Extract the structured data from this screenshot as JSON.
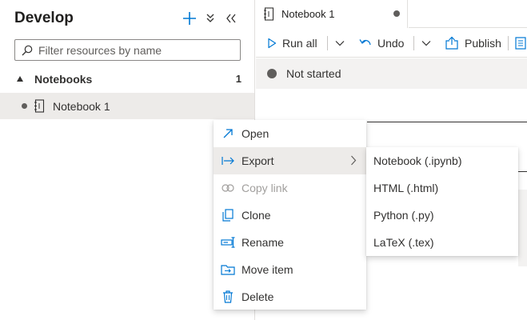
{
  "panel": {
    "title": "Develop",
    "add_icon": "plus-icon",
    "collapse_icon": "double-chevron-down-icon",
    "close_icon": "double-chevron-left-icon",
    "filter_placeholder": "Filter resources by name",
    "group": {
      "label": "Notebooks",
      "count": "1"
    },
    "item": {
      "label": "Notebook 1"
    }
  },
  "tab": {
    "label": "Notebook 1"
  },
  "toolbar": {
    "run_all_label": "Run all",
    "undo_label": "Undo",
    "publish_label": "Publish"
  },
  "status": {
    "text": "Not started"
  },
  "context_menu": {
    "items": [
      {
        "label": "Open",
        "icon": "open-arrow-icon"
      },
      {
        "label": "Export",
        "icon": "export-icon"
      },
      {
        "label": "Copy link",
        "icon": "link-icon"
      },
      {
        "label": "Clone",
        "icon": "clone-icon"
      },
      {
        "label": "Rename",
        "icon": "rename-icon"
      },
      {
        "label": "Move item",
        "icon": "move-item-icon"
      },
      {
        "label": "Delete",
        "icon": "trash-icon"
      }
    ]
  },
  "export_submenu": {
    "items": [
      {
        "label": "Notebook (.ipynb)"
      },
      {
        "label": "HTML (.html)"
      },
      {
        "label": "Python (.py)"
      },
      {
        "label": "LaTeX (.tex)"
      }
    ]
  },
  "colors": {
    "accent": "#0078d4",
    "hover": "#edebe9",
    "disabled": "#a19f9d"
  }
}
